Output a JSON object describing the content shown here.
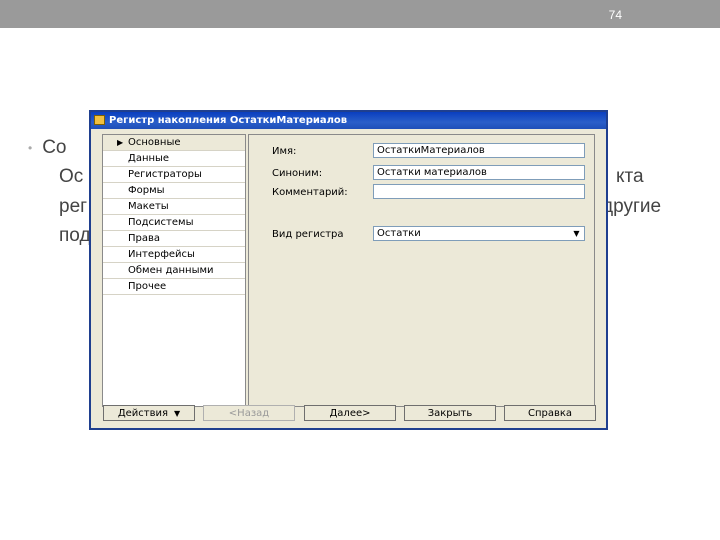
{
  "slide": {
    "number": "74"
  },
  "bullet": {
    "lines": [
      "Со",
      "Ос",
      "рег",
      "под"
    ],
    "right_fragments": [
      "кта",
      "другие"
    ]
  },
  "dialog": {
    "title": "Регистр накопления ОстаткиМатериалов",
    "nav_items": [
      "Основные",
      "Данные",
      "Регистраторы",
      "Формы",
      "Макеты",
      "Подсистемы",
      "Права",
      "Интерфейсы",
      "Обмен данными",
      "Прочее"
    ],
    "fields": {
      "name_label": "Имя:",
      "name_value": "ОстаткиМатериалов",
      "synonym_label": "Синоним:",
      "synonym_value": "Остатки материалов",
      "comment_label": "Комментарий:",
      "comment_value": "",
      "kind_label": "Вид регистра",
      "kind_value": "Остатки"
    },
    "buttons": {
      "actions": "Действия",
      "back": "<Назад",
      "next": "Далее>",
      "close": "Закрыть",
      "help": "Справка"
    }
  }
}
